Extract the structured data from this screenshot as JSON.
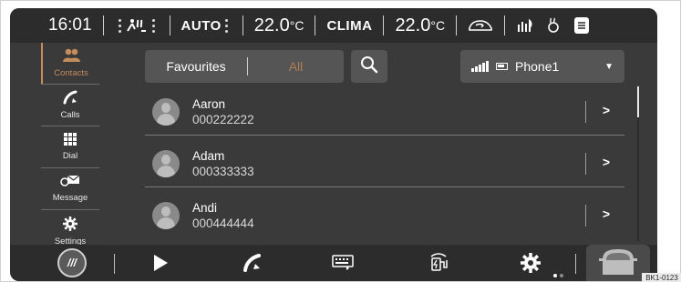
{
  "status_bar": {
    "time": "16:01",
    "auto_label": "AUTO",
    "temp_left": "22.0",
    "temp_left_unit": "°C",
    "clima_label": "CLIMA",
    "temp_right": "22.0",
    "temp_right_unit": "°C",
    "icons": [
      "seat-heat-icon",
      "recirculation-car-icon",
      "rear-defrost-icon",
      "steering-heat-icon",
      "menu-card-icon"
    ]
  },
  "sidebar": {
    "items": [
      {
        "label": "Contacts",
        "icon": "contacts-icon",
        "active": true
      },
      {
        "label": "Calls",
        "icon": "phone-icon",
        "active": false
      },
      {
        "label": "Dial",
        "icon": "keypad-icon",
        "active": false
      },
      {
        "label": "Message",
        "icon": "message-icon",
        "active": false
      },
      {
        "label": "Settings",
        "icon": "gear-icon",
        "active": false
      }
    ]
  },
  "filter": {
    "favourites_label": "Favourites",
    "all_label": "All"
  },
  "phone_selector": {
    "label": "Phone1"
  },
  "contacts": [
    {
      "name": "Aaron",
      "number": "000222222"
    },
    {
      "name": "Adam",
      "number": "000333333"
    },
    {
      "name": "Andi",
      "number": "000444444"
    }
  ],
  "bottom_bar": {
    "menu_label": "///",
    "icons": [
      "play-icon",
      "phone-icon",
      "keyboard-icon",
      "ev-charge-icon",
      "gear-icon",
      "car-icon"
    ]
  },
  "colors": {
    "accent": "#c48b5c",
    "background": "#3a3a3a",
    "bar": "#2c2c2c"
  },
  "figure_code": "BK1-0123"
}
